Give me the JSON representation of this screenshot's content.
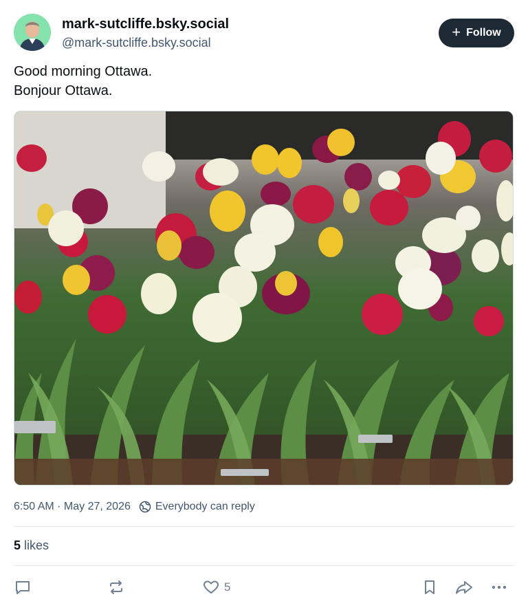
{
  "post": {
    "author": {
      "display_name": "mark-sutcliffe.bsky.social",
      "handle": "@mark-sutcliffe.bsky.social"
    },
    "follow_label": "Follow",
    "text_lines": [
      "Good morning Ottawa.",
      "Bonjour Ottawa."
    ],
    "image_alt": "Tulip garden with red, magenta, yellow and white tulips",
    "timestamp": "6:50 AM · May 27, 2026",
    "reply_setting": "Everybody can reply",
    "likes_count": "5",
    "likes_label": "likes",
    "like_action_count": "5"
  },
  "icons": {
    "follow": "plus-icon",
    "reply_setting": "globe-icon",
    "reply": "comment-icon",
    "repost": "repost-icon",
    "like": "heart-icon",
    "bookmark": "bookmark-icon",
    "share": "share-icon",
    "more": "more-icon"
  },
  "colors": {
    "follow_button_bg": "#1e2936",
    "muted_text": "#42576c",
    "icon_gray": "#6f8092"
  }
}
